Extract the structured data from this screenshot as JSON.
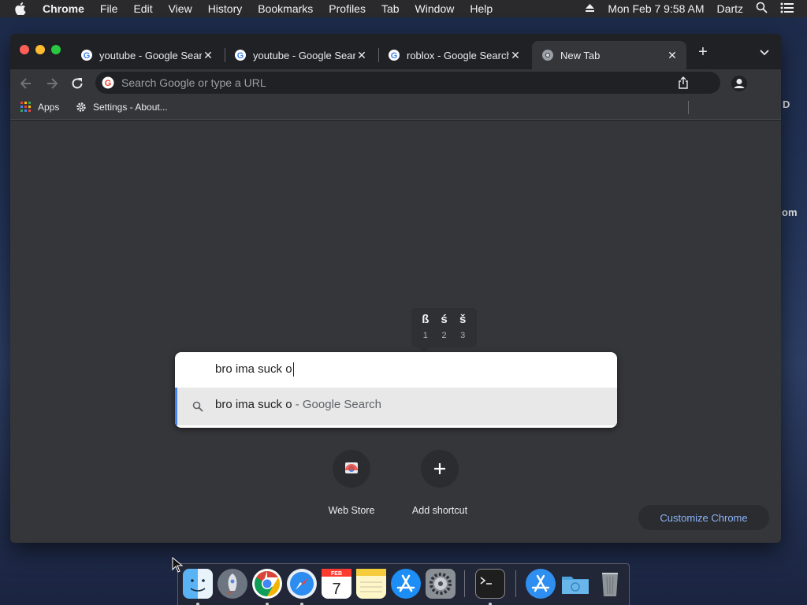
{
  "menubar": {
    "app_name": "Chrome",
    "items": [
      "File",
      "Edit",
      "View",
      "History",
      "Bookmarks",
      "Profiles",
      "Tab",
      "Window",
      "Help"
    ],
    "clock": "Mon Feb 7  9:58 AM",
    "user": "Dartz"
  },
  "desktop_peek": {
    "text_top": "D",
    "text_mid": "om"
  },
  "tabs": [
    {
      "title": "youtube - Google Search",
      "favicon": "google-icon",
      "active": false
    },
    {
      "title": "youtube - Google Search",
      "favicon": "google-icon",
      "active": false
    },
    {
      "title": "roblox - Google Search",
      "favicon": "google-icon",
      "active": false
    },
    {
      "title": "New Tab",
      "favicon": "chrome-icon",
      "active": true
    }
  ],
  "omnibox": {
    "placeholder": "Search Google or type a URL"
  },
  "bookmarks": [
    {
      "label": "Apps",
      "icon": "apps-grid-icon"
    },
    {
      "label": "Settings - About...",
      "icon": "gear-icon"
    }
  ],
  "search": {
    "query": "bro ima suck o",
    "suggestion_query": "bro ima suck o",
    "suggestion_suffix": " - Google Search"
  },
  "accent_popup": [
    {
      "char": "ß",
      "num": "1"
    },
    {
      "char": "ś",
      "num": "2"
    },
    {
      "char": "š",
      "num": "3"
    }
  ],
  "shortcuts": [
    {
      "label": "Web Store",
      "icon": "web-store-icon"
    },
    {
      "label": "Add shortcut",
      "icon": "plus-icon"
    }
  ],
  "customize_label": "Customize Chrome",
  "dock": [
    "finder-icon",
    "launchpad-icon",
    "chrome-icon",
    "safari-icon",
    "calendar-icon",
    "notes-icon",
    "app-store-icon",
    "system-preferences-icon",
    "terminal-icon",
    "applications-folder-icon",
    "downloads-folder-icon",
    "trash-icon"
  ],
  "calendar_icon": {
    "month": "FEB",
    "day": "7"
  },
  "colors": {
    "accent": "#8ab4f8",
    "selection_bar": "#4285f4",
    "window_bg": "#35363a"
  }
}
